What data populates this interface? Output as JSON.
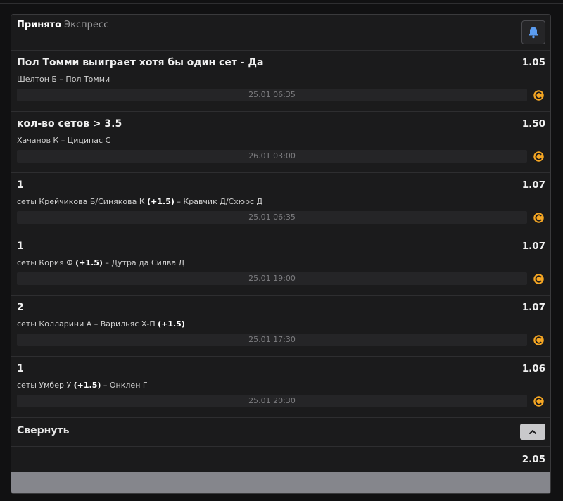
{
  "header": {
    "status": "Принято",
    "bet_type": "Экспресс"
  },
  "events": [
    {
      "pick": "Пол Томми выиграет хотя бы один сет - Да",
      "odds": "1.05",
      "match_prefix": "",
      "match_before": "Шелтон Б – Пол Томми",
      "handicap": "",
      "match_after": "",
      "datetime": "25.01 06:35",
      "icon": "tennis-ball-icon"
    },
    {
      "pick": "кол-во сетов > 3.5",
      "odds": "1.50",
      "match_prefix": "",
      "match_before": "Хачанов К – Циципас С",
      "handicap": "",
      "match_after": "",
      "datetime": "26.01 03:00",
      "icon": "tennis-ball-icon"
    },
    {
      "pick": "1",
      "odds": "1.07",
      "match_prefix": "сеты ",
      "match_before": "Крейчикова Б/Синякова К ",
      "handicap": "(+1.5)",
      "match_after": " – Кравчик Д/Схюрс Д",
      "datetime": "25.01 06:35",
      "icon": "tennis-ball-icon"
    },
    {
      "pick": "1",
      "odds": "1.07",
      "match_prefix": "сеты ",
      "match_before": "Кория Ф ",
      "handicap": "(+1.5)",
      "match_after": " – Дутра да Силва Д",
      "datetime": "25.01 19:00",
      "icon": "tennis-ball-icon"
    },
    {
      "pick": "2",
      "odds": "1.07",
      "match_prefix": "сеты ",
      "match_before": "Колларини А – Варильяс Х-П ",
      "handicap": "(+1.5)",
      "match_after": "",
      "datetime": "25.01 17:30",
      "icon": "tennis-ball-icon"
    },
    {
      "pick": "1",
      "odds": "1.06",
      "match_prefix": "сеты ",
      "match_before": "Умбер У ",
      "handicap": "(+1.5)",
      "match_after": " – Онклен Г",
      "datetime": "25.01 20:30",
      "icon": "tennis-ball-icon"
    }
  ],
  "collapse": {
    "label": "Свернуть"
  },
  "total": {
    "odds": "2.05"
  },
  "colors": {
    "accent_orange": "#f5a623",
    "bell_blue": "#5b9cf0"
  }
}
